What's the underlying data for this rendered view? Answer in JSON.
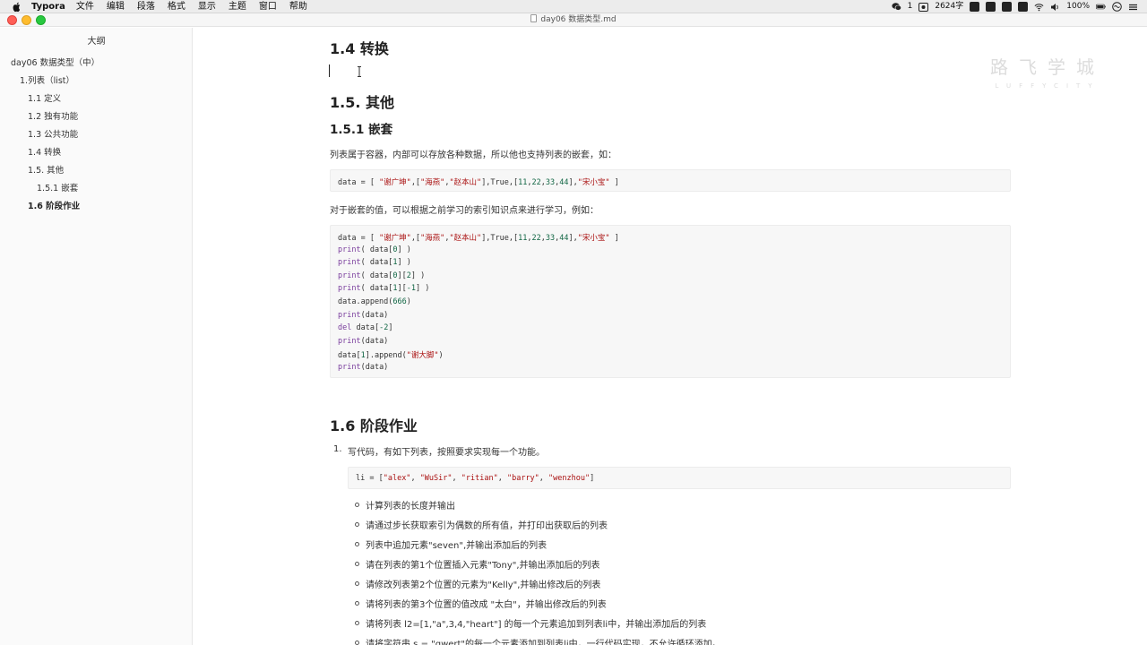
{
  "menubar": {
    "app_name": "Typora",
    "menus": [
      "文件",
      "编辑",
      "段落",
      "格式",
      "显示",
      "主题",
      "窗口",
      "帮助"
    ],
    "status": {
      "notification_count": "1",
      "word_count": "2624字",
      "battery": "100%"
    }
  },
  "window": {
    "title": "day06 数据类型.md"
  },
  "sidebar": {
    "title": "大纲",
    "items": [
      {
        "label": "day06 数据类型（中）"
      },
      {
        "label": "1.列表（list）"
      },
      {
        "label": "1.1 定义"
      },
      {
        "label": "1.2 独有功能"
      },
      {
        "label": "1.3 公共功能"
      },
      {
        "label": "1.4 转换"
      },
      {
        "label": "1.5. 其他"
      },
      {
        "label": "1.5.1 嵌套"
      },
      {
        "label": "1.6 阶段作业"
      }
    ]
  },
  "watermark": {
    "cn": "路飞学城",
    "en": "LUFFYCITY"
  },
  "doc": {
    "h_14": "1.4 转换",
    "h_15": "1.5. 其他",
    "h_151": "1.5.1 嵌套",
    "p1": "列表属于容器，内部可以存放各种数据，所以他也支持列表的嵌套，如：",
    "code1": [
      [
        [
          "t",
          "data = [ "
        ],
        [
          "s",
          "\"谢广坤\""
        ],
        [
          "t",
          ",["
        ],
        [
          "s",
          "\"海燕\""
        ],
        [
          "t",
          ","
        ],
        [
          "s",
          "\"赵本山\""
        ],
        [
          "t",
          "],True,["
        ],
        [
          "n",
          "11"
        ],
        [
          "t",
          ","
        ],
        [
          "n",
          "22"
        ],
        [
          "t",
          ","
        ],
        [
          "n",
          "33"
        ],
        [
          "t",
          ","
        ],
        [
          "n",
          "44"
        ],
        [
          "t",
          "],"
        ],
        [
          "s",
          "\"宋小宝\""
        ],
        [
          "t",
          " ]"
        ]
      ]
    ],
    "p2": "对于嵌套的值，可以根据之前学习的索引知识点来进行学习，例如：",
    "code2": [
      [
        [
          "t",
          "data = [ "
        ],
        [
          "s",
          "\"谢广坤\""
        ],
        [
          "t",
          ",["
        ],
        [
          "s",
          "\"海燕\""
        ],
        [
          "t",
          ","
        ],
        [
          "s",
          "\"赵本山\""
        ],
        [
          "t",
          "],True,["
        ],
        [
          "n",
          "11"
        ],
        [
          "t",
          ","
        ],
        [
          "n",
          "22"
        ],
        [
          "t",
          ","
        ],
        [
          "n",
          "33"
        ],
        [
          "t",
          ","
        ],
        [
          "n",
          "44"
        ],
        [
          "t",
          "],"
        ],
        [
          "s",
          "\"宋小宝\""
        ],
        [
          "t",
          " ]"
        ]
      ],
      [
        [
          "k",
          "print"
        ],
        [
          "t",
          "( data["
        ],
        [
          "n",
          "0"
        ],
        [
          "t",
          "] )"
        ]
      ],
      [
        [
          "k",
          "print"
        ],
        [
          "t",
          "( data["
        ],
        [
          "n",
          "1"
        ],
        [
          "t",
          "] )"
        ]
      ],
      [
        [
          "k",
          "print"
        ],
        [
          "t",
          "( data["
        ],
        [
          "n",
          "0"
        ],
        [
          "t",
          "]["
        ],
        [
          "n",
          "2"
        ],
        [
          "t",
          "] )"
        ]
      ],
      [
        [
          "k",
          "print"
        ],
        [
          "t",
          "( data["
        ],
        [
          "n",
          "1"
        ],
        [
          "t",
          "]["
        ],
        [
          "n",
          "-1"
        ],
        [
          "t",
          "] )"
        ]
      ],
      [
        [
          "t",
          "data.append("
        ],
        [
          "n",
          "666"
        ],
        [
          "t",
          ")"
        ]
      ],
      [
        [
          "k",
          "print"
        ],
        [
          "t",
          "(data)"
        ]
      ],
      [
        [
          "k",
          "del"
        ],
        [
          "t",
          " data["
        ],
        [
          "n",
          "-2"
        ],
        [
          "t",
          "]"
        ]
      ],
      [
        [
          "k",
          "print"
        ],
        [
          "t",
          "(data)"
        ]
      ],
      [
        [
          "t",
          "data["
        ],
        [
          "n",
          "1"
        ],
        [
          "t",
          "].append("
        ],
        [
          "s",
          "\"谢大脚\""
        ],
        [
          "t",
          ")"
        ]
      ],
      [
        [
          "k",
          "print"
        ],
        [
          "t",
          "(data)"
        ]
      ]
    ],
    "h_16": "1.6 阶段作业",
    "ol1_num": "1.",
    "ol1_text": "写代码，有如下列表，按照要求实现每一个功能。",
    "code3": [
      [
        [
          "t",
          "li = ["
        ],
        [
          "s",
          "\"alex\""
        ],
        [
          "t",
          ", "
        ],
        [
          "s",
          "\"WuSir\""
        ],
        [
          "t",
          ", "
        ],
        [
          "s",
          "\"ritian\""
        ],
        [
          "t",
          ", "
        ],
        [
          "s",
          "\"barry\""
        ],
        [
          "t",
          ", "
        ],
        [
          "s",
          "\"wenzhou\""
        ],
        [
          "t",
          "]"
        ]
      ]
    ],
    "bullets": [
      "计算列表的长度并输出",
      "请通过步长获取索引为偶数的所有值，并打印出获取后的列表",
      "列表中追加元素\"seven\",并输出添加后的列表",
      "请在列表的第1个位置插入元素\"Tony\",并输出添加后的列表",
      "请修改列表第2个位置的元素为\"Kelly\",并输出修改后的列表",
      "请将列表的第3个位置的值改成 \"太白\"，并输出修改后的列表",
      "请将列表 l2=[1,\"a\",3,4,\"heart\"] 的每一个元素追加到列表li中，并输出添加后的列表",
      "请将字符串 s = \"qwert\"的每一个元素添加到列表li中，一行代码实现，不允许循环添加。"
    ]
  }
}
